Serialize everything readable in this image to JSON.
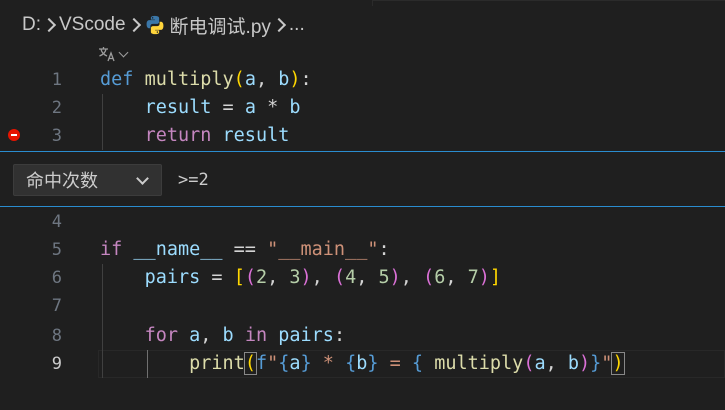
{
  "breadcrumb": {
    "drive": "D:",
    "folder": "VScode",
    "file": "断电调试.py",
    "more": "..."
  },
  "codelens": {
    "icon": "translate-icon"
  },
  "lines": {
    "l1": {
      "num": "1"
    },
    "l2": {
      "num": "2"
    },
    "l3": {
      "num": "3"
    },
    "l4": {
      "num": "4"
    },
    "l5": {
      "num": "5"
    },
    "l6": {
      "num": "6"
    },
    "l7": {
      "num": "7"
    },
    "l8": {
      "num": "8"
    },
    "l9": {
      "num": "9"
    }
  },
  "breakpoint_widget": {
    "type_label": "命中次数",
    "condition_value": ">=2"
  },
  "colors": {
    "accent_border": "#2a8ccf",
    "breakpoint": "#e51400",
    "keyword": "#569cd6",
    "control": "#c586c0",
    "function": "#dcdcaa",
    "string": "#ce9178"
  }
}
